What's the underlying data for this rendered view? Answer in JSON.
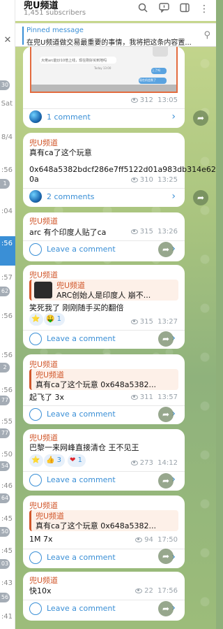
{
  "header": {
    "title": "兜U频道",
    "subscribers": "1,451 subscribers"
  },
  "pinned": {
    "label": "Pinned message",
    "text": "在兜U频道做交易最重要的事情，我将把这条内容置..."
  },
  "sidebar": {
    "items": [
      {
        "text": "30",
        "type": "badge"
      },
      {
        "text": "Sat",
        "type": "label"
      },
      {
        "text": "8/4",
        "type": "label"
      },
      {
        "text": ":56",
        "type": "label"
      },
      {
        "text": "1",
        "type": "badge"
      },
      {
        "text": ":04",
        "type": "label"
      },
      {
        "text": ":56",
        "type": "active"
      },
      {
        "text": ":57",
        "type": "label"
      },
      {
        "text": "62",
        "type": "badge"
      },
      {
        "text": ":56",
        "type": "label"
      },
      {
        "text": ":56",
        "type": "label"
      },
      {
        "text": "2",
        "type": "badge"
      },
      {
        "text": ":56",
        "type": "label"
      },
      {
        "text": "77",
        "type": "badge"
      },
      {
        "text": ":55",
        "type": "label"
      },
      {
        "text": "77",
        "type": "badge"
      },
      {
        "text": ":50",
        "type": "label"
      },
      {
        "text": "54",
        "type": "badge"
      },
      {
        "text": ":46",
        "type": "label"
      },
      {
        "text": "64",
        "type": "badge"
      },
      {
        "text": ":45",
        "type": "label"
      },
      {
        "text": "50",
        "type": "badge"
      },
      {
        "text": ":45",
        "type": "label"
      },
      {
        "text": "03",
        "type": "badge"
      },
      {
        "text": ":43",
        "type": "label"
      },
      {
        "text": "56",
        "type": "badge"
      },
      {
        "text": ":41",
        "type": "label"
      }
    ]
  },
  "messages": [
    {
      "id": "m1",
      "views": "312",
      "time": "13:05",
      "comments": "1 comment",
      "media_texts": [
        "大佬arc能炒10倍上线，现在刚好买到地吗",
        "Today 13:00",
        "上了吗",
        "现在机会跌了"
      ]
    },
    {
      "id": "m2",
      "author": "兜U频道",
      "line1": "真有ca了这个玩意",
      "line2": "0x648a5382bdcf286e7ff5122d01a983db314e62",
      "line3": "0a",
      "views": "310",
      "time": "13:25",
      "comments": "2 comments"
    },
    {
      "id": "m3",
      "author": "兜U频道",
      "line1": "arc 有个印度人贴了ca",
      "views": "315",
      "time": "13:26",
      "comments": "Leave a comment"
    },
    {
      "id": "m4",
      "author": "兜U频道",
      "reply_author": "兜U频道",
      "reply_text": "ARC创始人是印度人  崩不...",
      "line1": "笑死我了 刚刚随手买的翻倍",
      "reactions": [
        {
          "emoji": "⭐",
          "count": ""
        },
        {
          "emoji": "🤑",
          "count": "1"
        }
      ],
      "views": "315",
      "time": "13:27",
      "comments": "Leave a comment"
    },
    {
      "id": "m5",
      "author": "兜U频道",
      "reply_author": "兜U频道",
      "reply_text": "真有ca了这个玩意  0x648a5382...",
      "line1": "起飞了 3x",
      "views": "311",
      "time": "13:57",
      "comments": "Leave a comment"
    },
    {
      "id": "m6",
      "author": "兜U频道",
      "line1": "巴黎一来网峰直接清仓 王不见王",
      "reactions": [
        {
          "emoji": "⭐",
          "count": ""
        },
        {
          "emoji": "👍",
          "count": "3"
        },
        {
          "emoji": "❤",
          "count": "1"
        }
      ],
      "views": "273",
      "time": "14:12",
      "comments": "Leave a comment"
    },
    {
      "id": "m7",
      "author": "兜U频道",
      "reply_author": "兜U频道",
      "reply_text": "真有ca了这个玩意  0x648a5382...",
      "line1": "1M  7x",
      "views": "94",
      "time": "17:50",
      "comments": "Leave a comment"
    },
    {
      "id": "m8",
      "author": "兜U频道",
      "line1": "快10x",
      "views": "22",
      "time": "17:56",
      "comments": "Leave a comment"
    }
  ]
}
